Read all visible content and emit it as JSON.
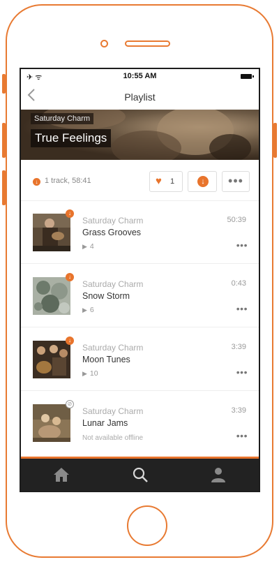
{
  "status_bar": {
    "signal": "✈ ᯤ",
    "time": "10:55 AM"
  },
  "nav": {
    "back_icon": "chevron-left-icon",
    "title": "Playlist"
  },
  "header": {
    "artist": "Saturday Charm",
    "title": "True Feelings"
  },
  "summary": {
    "text": "1 track, 58:41",
    "likes": "1"
  },
  "tracks": [
    {
      "artist": "Saturday Charm",
      "title": "Grass Grooves",
      "duration": "50:39",
      "plays": "4",
      "status": "downloaded"
    },
    {
      "artist": "Saturday Charm",
      "title": "Snow Storm",
      "duration": "0:43",
      "plays": "6",
      "status": "downloaded"
    },
    {
      "artist": "Saturday Charm",
      "title": "Moon Tunes",
      "duration": "3:39",
      "plays": "10",
      "status": "downloaded"
    },
    {
      "artist": "Saturday Charm",
      "title": "Lunar Jams",
      "duration": "3:39",
      "offline_note": "Not available offline",
      "status": "unavailable"
    }
  ],
  "tab_bar": {
    "items": [
      "home-icon",
      "search-icon",
      "profile-icon"
    ]
  },
  "colors": {
    "accent": "#e87a32",
    "tab_bar_bg": "#222222"
  }
}
